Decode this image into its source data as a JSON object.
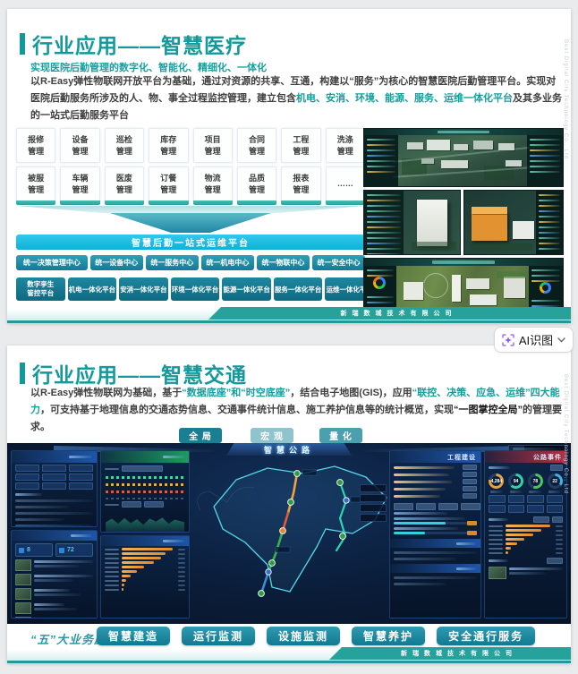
{
  "ai_button": {
    "label": "AI识图",
    "icon": "ai-scan-icon",
    "accent": "#8b5cf6"
  },
  "company_footer": "新瑞数城技术有限公司",
  "watermark": "Best Digital City Technology Co., Ltd",
  "colors": {
    "title_teal": "#14999b",
    "cyan_bar": "#0fb0da",
    "button_teal": "#147b95",
    "dashboard_bg": "#0a1c38"
  },
  "slide1": {
    "title": "行业应用——智慧医疗",
    "subtitle": "实现医院后勤管理的数字化、智能化、精细化、一体化",
    "para": {
      "s1": "以R-Easy弹性物联网开放平台为基础，通过对资源的共享、互通，构建以“服务”为核心的智慧医院后勤管理平台。实现对医院后勤服务所涉及的人、物、事全过程监控管理，建立包含",
      "s2": "机电、安消、环境、能源、服务、运维一体化平台",
      "s3": "及其多业务的一站式后勤服务平台"
    },
    "modules": [
      "报修管理",
      "设备管理",
      "巡检管理",
      "库存管理",
      "项目管理",
      "合同管理",
      "工程管理",
      "洗涤管理",
      "被服管理",
      "车辆管理",
      "医废管理",
      "订餐管理",
      "物流管理",
      "品质管理",
      "报表管理",
      "……"
    ],
    "platform_bar": "智慧后勤一站式运维平台",
    "centers": [
      "统一决策管理中心",
      "统一设备中心",
      "统一服务中心",
      "统一机电中心",
      "统一物联中心",
      "统一安全中心"
    ],
    "platforms": [
      "数字孪生管控平台",
      "机电一体化平台",
      "安消一体化平台",
      "环境一体化平台",
      "能源一体化平台",
      "服务一体化平台",
      "运维一体化平台"
    ]
  },
  "slide2": {
    "title": "行业应用——智慧交通",
    "para": {
      "s1": "以R-Easy弹性物联网为基础，基于",
      "s2": "“数据底座”和“时空底座”",
      "s3": "，结合电子地图(GIS)，应用",
      "s4": "“联控、决策、应急、运维”四大能力",
      "s5": "，可支持基于地理信息的交通态势信息、交通事件统计信息、施工养护信息等的统计概览，实现",
      "s6": "“一图掌控全局”",
      "s7": "的管理要求。"
    },
    "view_buttons": [
      "全 局",
      "宏 观",
      "量 化"
    ],
    "dashboard": {
      "title": "智慧公路",
      "panel_construction": "工程建设",
      "panel_events": "公路事件",
      "gauges": [
        "4,284",
        "94",
        "78",
        "22"
      ],
      "stat_left": "8",
      "stat_right": "72"
    },
    "business_label": "“五”大业务应用",
    "business_buttons": [
      "智慧建造",
      "运行监测",
      "设施监测",
      "智慧养护",
      "安全通行服务"
    ]
  }
}
